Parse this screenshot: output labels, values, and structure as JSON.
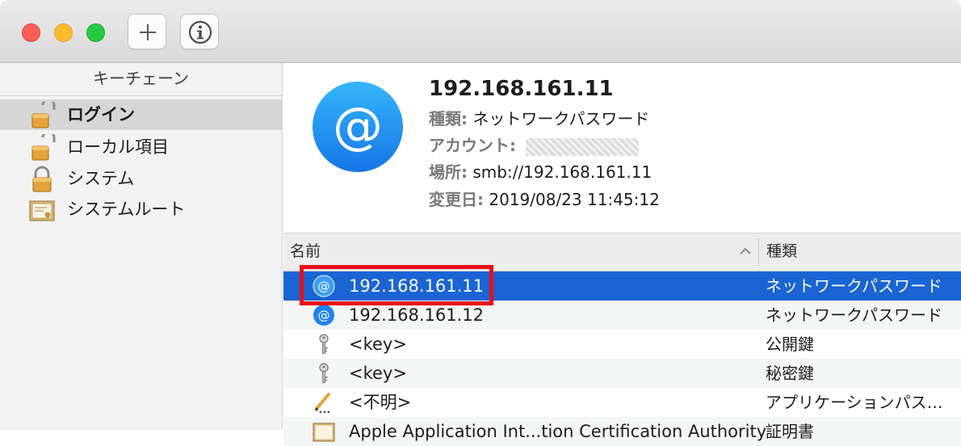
{
  "window": {
    "add_icon": "plus-icon",
    "info_icon": "info-icon"
  },
  "sidebar": {
    "header": "キーチェーン",
    "items": [
      {
        "label": "ログイン",
        "icon": "unlocked-padlock-icon",
        "selected": true
      },
      {
        "label": "ローカル項目",
        "icon": "unlocked-padlock-icon",
        "selected": false
      },
      {
        "label": "システム",
        "icon": "locked-padlock-icon",
        "selected": false
      },
      {
        "label": "システムルート",
        "icon": "certificate-icon",
        "selected": false
      }
    ]
  },
  "detail": {
    "title": "192.168.161.11",
    "kind_key": "種類:",
    "kind_value": "ネットワークパスワード",
    "account_key": "アカウント:",
    "location_key": "場所:",
    "location_value": "smb://192.168.161.11",
    "modified_key": "変更日:",
    "modified_value": "2019/08/23 11:45:12",
    "icon": "at-sign-icon"
  },
  "list": {
    "columns": {
      "name": "名前",
      "kind": "種類"
    },
    "rows": [
      {
        "name": "192.168.161.11",
        "kind": "ネットワークパスワード",
        "icon": "at-sign-icon",
        "selected": true
      },
      {
        "name": "192.168.161.12",
        "kind": "ネットワークパスワード",
        "icon": "at-sign-icon",
        "selected": false
      },
      {
        "name": "<key>",
        "kind": "公開鍵",
        "icon": "key-icon",
        "selected": false
      },
      {
        "name": "<key>",
        "kind": "秘密鍵",
        "icon": "key-icon",
        "selected": false
      },
      {
        "name": "<不明>",
        "kind": "アプリケーションパス…",
        "icon": "pen-icon",
        "selected": false
      },
      {
        "name": "Apple Application Int...tion Certification Authority",
        "kind": "証明書",
        "icon": "certificate-icon",
        "selected": false
      }
    ]
  },
  "annotation": {
    "color": "#e8101a"
  }
}
